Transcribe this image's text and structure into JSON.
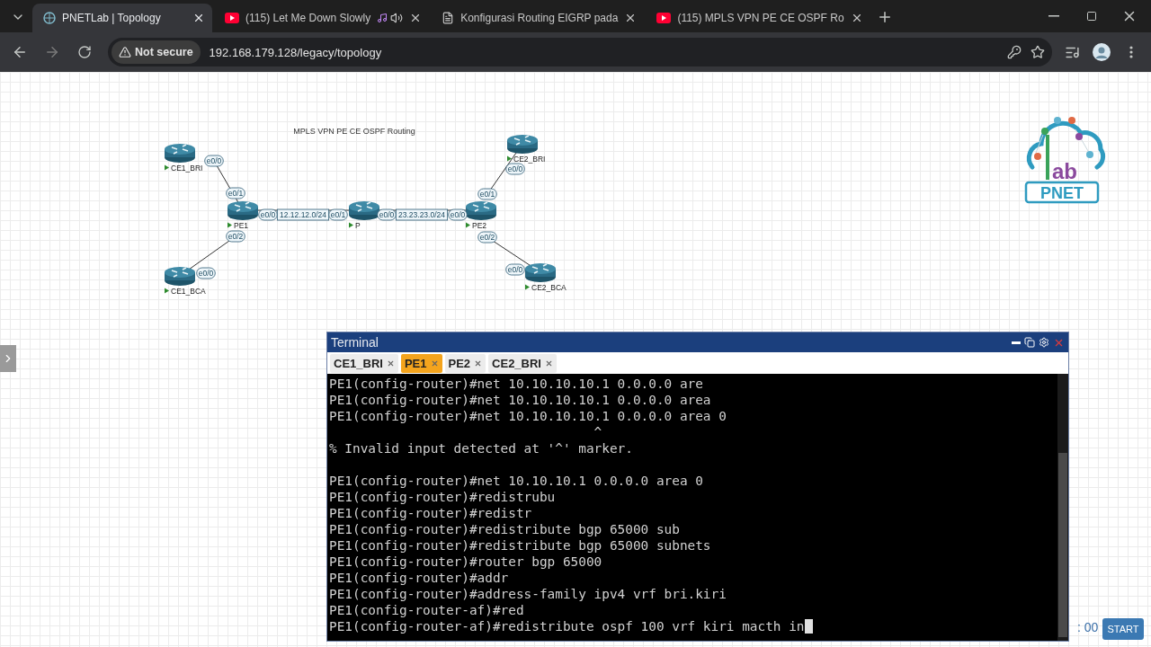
{
  "browser": {
    "tabs": [
      {
        "title": "PNETLab | Topology",
        "selected": true,
        "kind": "site"
      },
      {
        "title": "(115) Let Me Down Slowly",
        "selected": false,
        "kind": "video",
        "playing": true
      },
      {
        "title": "Konfigurasi Routing EIGRP pada",
        "selected": false,
        "kind": "page"
      },
      {
        "title": "(115) MPLS VPN PE CE OSPF Ro",
        "selected": false,
        "kind": "video"
      }
    ],
    "security": "Not secure",
    "url": "192.168.179.128/legacy/topology"
  },
  "topology": {
    "title": "MPLS VPN PE CE OSPF Routing",
    "nodes": [
      {
        "name": "CE1_BRI"
      },
      {
        "name": "PE1"
      },
      {
        "name": "CE1_BCA"
      },
      {
        "name": "P"
      },
      {
        "name": "PE2"
      },
      {
        "name": "CE2_BRI"
      },
      {
        "name": "CE2_BCA"
      }
    ],
    "links": [
      {
        "ports": [
          "e0/0",
          "e0/1"
        ]
      },
      {
        "ports": [
          "e0/2",
          "e0/0"
        ]
      },
      {
        "ports": [
          "e0/0",
          "e0/1"
        ],
        "network": "12.12.12.0/24"
      },
      {
        "ports": [
          "e0/0",
          "e0/0"
        ],
        "network": "23.23.23.0/24"
      },
      {
        "ports": [
          "e0/1",
          "e0/0"
        ]
      },
      {
        "ports": [
          "e0/2",
          "e0/0"
        ]
      }
    ]
  },
  "logo": {
    "letters": "ab",
    "wordmark": "PNET"
  },
  "terminal": {
    "title": "Terminal",
    "tabs": [
      {
        "label": "CE1_BRI",
        "selected": false
      },
      {
        "label": "PE1",
        "selected": true
      },
      {
        "label": "PE2",
        "selected": false
      },
      {
        "label": "CE2_BRI",
        "selected": false
      }
    ],
    "blocks": [
      {
        "lines": [
          "PE1(config-router)#net 10.10.10.10.1 0.0.0.0 are",
          "PE1(config-router)#net 10.10.10.10.1 0.0.0.0 area",
          "PE1(config-router)#net 10.10.10.10.1 0.0.0.0 area 0",
          "                                  ^",
          "% Invalid input detected at '^' marker."
        ]
      },
      {
        "lines": [
          "PE1(config-router)#net 10.10.10.1 0.0.0.0 area 0",
          "PE1(config-router)#redistrubu",
          "PE1(config-router)#redistr",
          "PE1(config-router)#redistribute bgp 65000 sub",
          "PE1(config-router)#redistribute bgp 65000 subnets",
          "PE1(config-router)#router bgp 65000",
          "PE1(config-router)#addr",
          "PE1(config-router)#address-family ipv4 vrf bri.kiri",
          "PE1(config-router-af)#red",
          "PE1(config-router-af)#redistribute ospf 100 vrf kiri macth in"
        ]
      }
    ]
  },
  "timer": ": 00",
  "start_button": "START"
}
